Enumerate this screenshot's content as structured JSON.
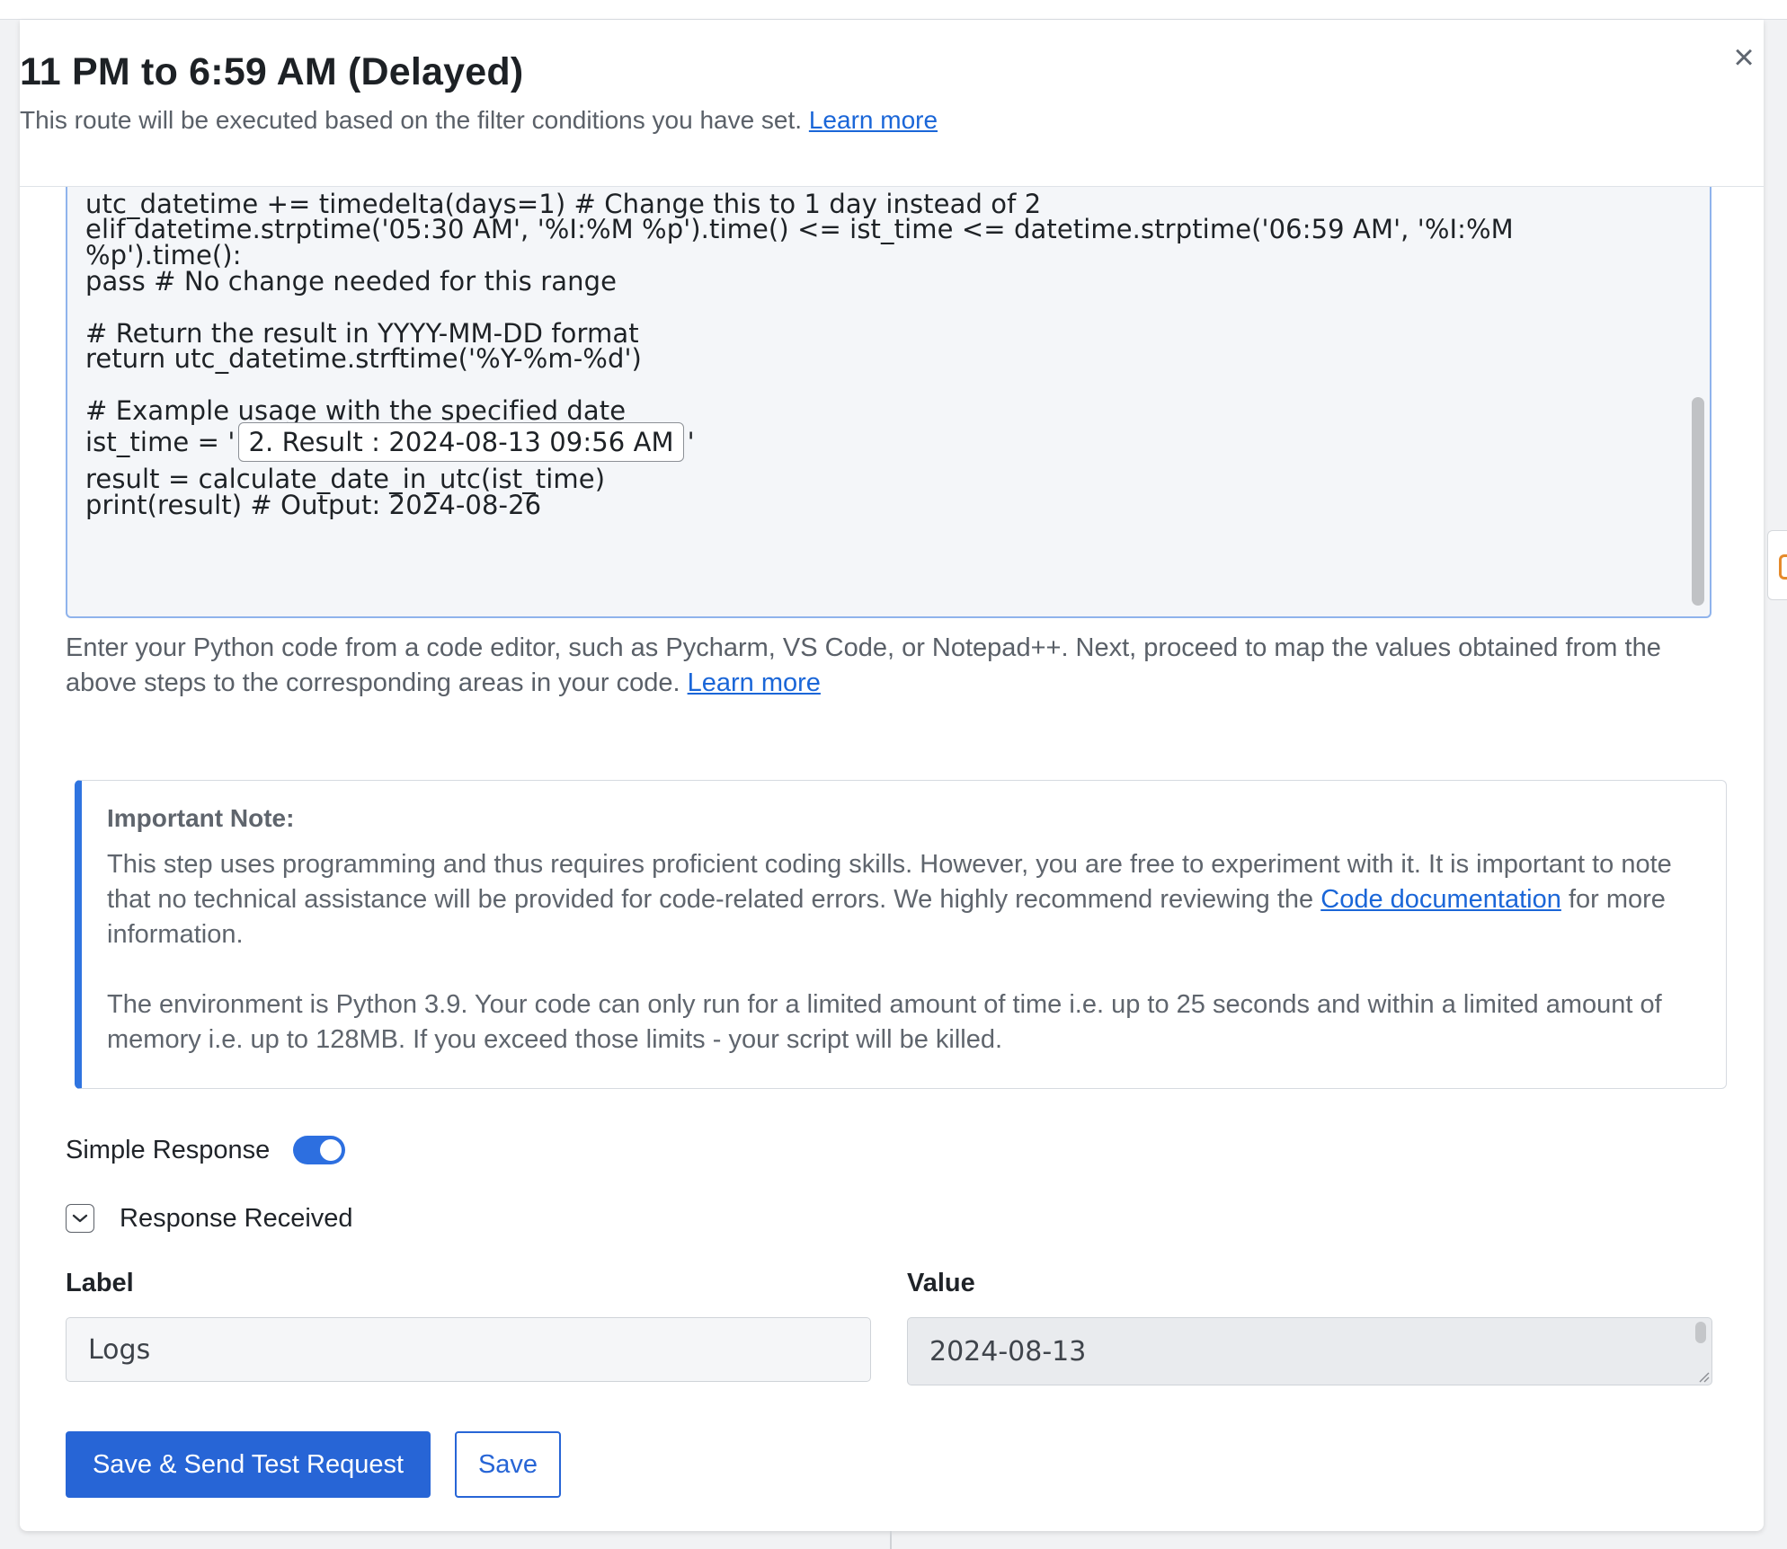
{
  "header": {
    "title": "11 PM to 6:59 AM (Delayed)",
    "subtitle": "This route will be executed based on the filter conditions you have set.",
    "learn_more": "Learn more",
    "close_glyph": "×"
  },
  "code": {
    "lines": [
      "utc_datetime += timedelta(days=1) # Change this to 1 day instead of 2",
      "elif datetime.strptime('05:30 AM', '%I:%M %p').time() <= ist_time <= datetime.strptime('06:59 AM', '%I:%M",
      "%p').time():",
      "pass # No change needed for this range",
      "# Return the result in YYYY-MM-DD format",
      "return utc_datetime.strftime('%Y-%m-%d')",
      "# Example usage with the specified date",
      "result = calculate_date_in_utc(ist_time)",
      "print(result) # Output: 2024-08-26"
    ],
    "ist_prefix": "ist_time = '",
    "ist_chip": "2. Result : 2024-08-13 09:56 AM",
    "ist_suffix": "'"
  },
  "helper": {
    "text": "Enter your Python code from a code editor, such as Pycharm, VS Code, or Notepad++. Next, proceed to map the values obtained from the above steps to the corresponding areas in your code.",
    "learn_more": "Learn more"
  },
  "note": {
    "title": "Important Note:",
    "p1_before": "This step uses programming and thus requires proficient coding skills. However, you are free to experiment with it. It is important to note that no technical assistance will be provided for code-related errors. We highly recommend reviewing the",
    "p1_link": "Code documentation",
    "p1_after": "for more information.",
    "p2": "The environment is Python 3.9. Your code can only run for a limited amount of time i.e. up to 25 seconds and within a limited amount of memory i.e. up to 128MB. If you exceed those limits - your script will be killed."
  },
  "simple_response": {
    "label": "Simple Response",
    "enabled": true
  },
  "response_received": {
    "label": "Response Received"
  },
  "table": {
    "label_header": "Label",
    "value_header": "Value",
    "label_value": "Logs",
    "value_value": "2024-08-13"
  },
  "actions": {
    "primary": "Save & Send Test Request",
    "secondary": "Save"
  },
  "colors": {
    "accent": "#2765d6",
    "note_border": "#2f74e0",
    "link": "#1a66d8"
  }
}
